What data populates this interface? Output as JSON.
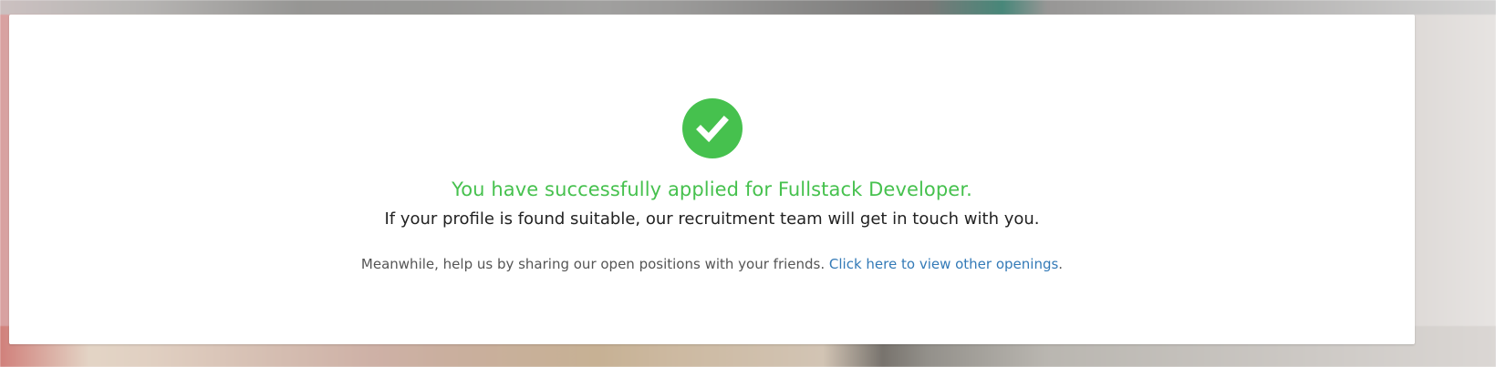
{
  "success": {
    "icon": "checkmark-circle-icon",
    "title": "You have successfully applied for Fullstack Developer.",
    "subtitle": "If your profile is found suitable, our recruitment team will get in touch with you.",
    "meanwhile_prefix": "Meanwhile, help us by sharing our open positions with your friends.",
    "link_text": "Click here to view other openings",
    "link_suffix": "."
  },
  "colors": {
    "success_green": "#46c14e",
    "link_blue": "#337ab7"
  }
}
